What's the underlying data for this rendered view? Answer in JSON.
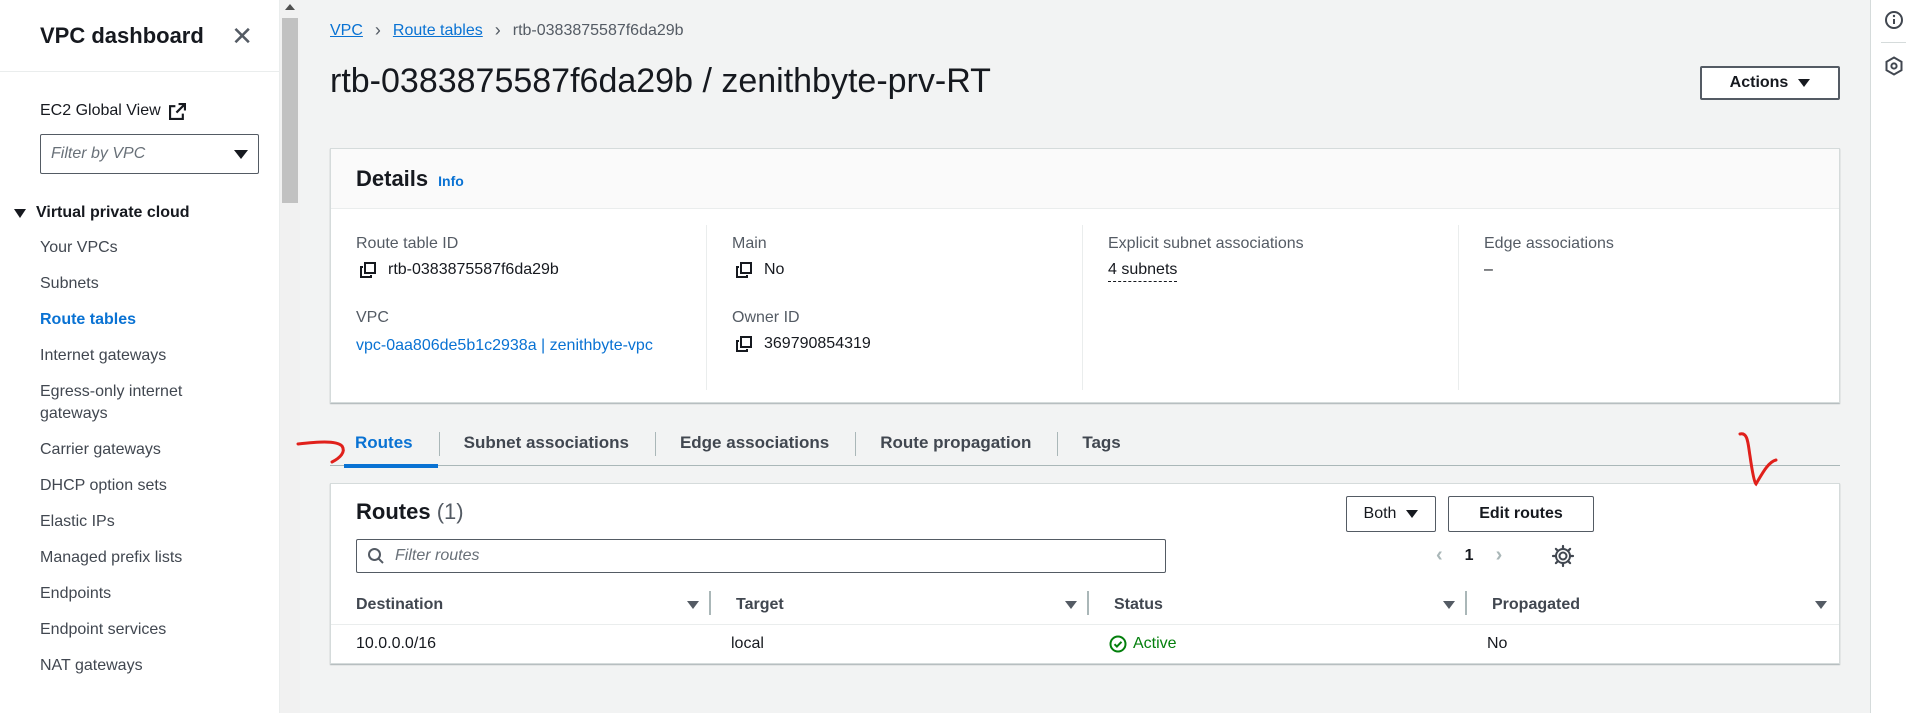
{
  "sidebar": {
    "title": "VPC dashboard",
    "global_view": "EC2 Global View",
    "filter_placeholder": "Filter by VPC",
    "section": "Virtual private cloud",
    "items": [
      {
        "label": "Your VPCs"
      },
      {
        "label": "Subnets"
      },
      {
        "label": "Route tables",
        "active": true
      },
      {
        "label": "Internet gateways"
      },
      {
        "label": "Egress-only internet gateways"
      },
      {
        "label": "Carrier gateways"
      },
      {
        "label": "DHCP option sets"
      },
      {
        "label": "Elastic IPs"
      },
      {
        "label": "Managed prefix lists"
      },
      {
        "label": "Endpoints"
      },
      {
        "label": "Endpoint services"
      },
      {
        "label": "NAT gateways"
      }
    ]
  },
  "breadcrumb": {
    "vpc": "VPC",
    "route_tables": "Route tables",
    "current": "rtb-0383875587f6da29b"
  },
  "page": {
    "title": "rtb-0383875587f6da29b / zenithbyte-prv-RT",
    "actions_label": "Actions"
  },
  "details": {
    "title": "Details",
    "info": "Info",
    "route_table_id_label": "Route table ID",
    "route_table_id": "rtb-0383875587f6da29b",
    "vpc_label": "VPC",
    "vpc_value": "vpc-0aa806de5b1c2938a | zenithbyte-vpc",
    "main_label": "Main",
    "main_value": "No",
    "owner_label": "Owner ID",
    "owner_value": "369790854319",
    "explicit_label": "Explicit subnet associations",
    "explicit_value": "4 subnets",
    "edge_label": "Edge associations",
    "edge_value": "–"
  },
  "tabs": [
    {
      "label": "Routes",
      "active": true
    },
    {
      "label": "Subnet associations"
    },
    {
      "label": "Edge associations"
    },
    {
      "label": "Route propagation"
    },
    {
      "label": "Tags"
    }
  ],
  "routes": {
    "title": "Routes",
    "count": "(1)",
    "both_label": "Both",
    "edit_label": "Edit routes",
    "filter_placeholder": "Filter routes",
    "page": "1",
    "columns": [
      "Destination",
      "Target",
      "Status",
      "Propagated"
    ],
    "rows": [
      {
        "destination": "10.0.0.0/16",
        "target": "local",
        "status": "Active",
        "propagated": "No"
      }
    ]
  },
  "colors": {
    "link": "#0972d3",
    "success": "#037f0c",
    "annotation": "#e0201b"
  }
}
